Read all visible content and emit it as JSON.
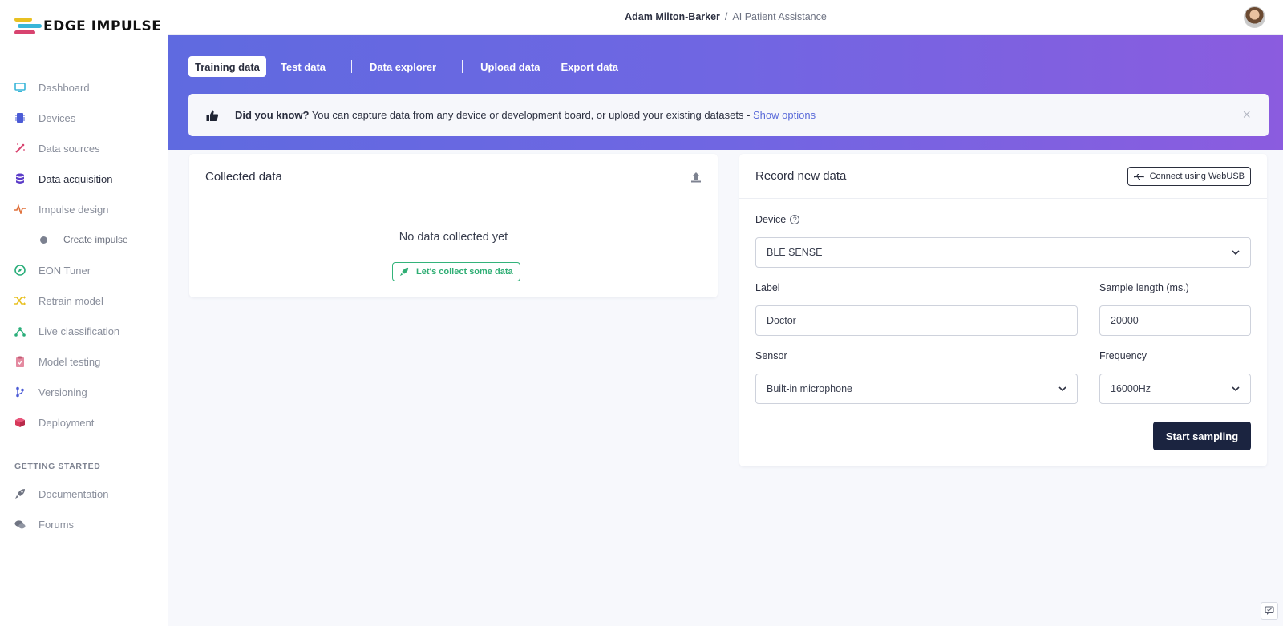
{
  "brand": {
    "name": "EDGE IMPULSE"
  },
  "sidebar": {
    "items": [
      {
        "label": "Dashboard",
        "icon": "monitor-icon",
        "color": "#38b6d8"
      },
      {
        "label": "Devices",
        "icon": "chip-icon",
        "color": "#4b5bd6"
      },
      {
        "label": "Data sources",
        "icon": "wand-icon",
        "color": "#d8436f"
      },
      {
        "label": "Data acquisition",
        "icon": "database-icon",
        "color": "#5b3bc8"
      },
      {
        "label": "Impulse design",
        "icon": "pulse-icon",
        "color": "#e0703a"
      },
      {
        "label": "Create impulse",
        "icon": "dot-icon",
        "color": "#7c8190"
      },
      {
        "label": "EON Tuner",
        "icon": "compass-icon",
        "color": "#2aae7a"
      },
      {
        "label": "Retrain model",
        "icon": "shuffle-icon",
        "color": "#e8c021"
      },
      {
        "label": "Live classification",
        "icon": "nodes-icon",
        "color": "#2aae7a"
      },
      {
        "label": "Model testing",
        "icon": "clipboard-check-icon",
        "color": "#e48aa0"
      },
      {
        "label": "Versioning",
        "icon": "branch-icon",
        "color": "#4b5bd6"
      },
      {
        "label": "Deployment",
        "icon": "box-icon",
        "color": "#d83a5a"
      }
    ],
    "section_title": "GETTING STARTED",
    "help_items": [
      {
        "label": "Documentation",
        "icon": "rocket-icon"
      },
      {
        "label": "Forums",
        "icon": "chat-icon"
      }
    ]
  },
  "topbar": {
    "user": "Adam Milton-Barker",
    "separator": "/",
    "project": "AI Patient Assistance"
  },
  "tabs": [
    {
      "label": "Training data",
      "active": true
    },
    {
      "label": "Test data"
    },
    {
      "label": "Data explorer"
    },
    {
      "label": "Upload data"
    },
    {
      "label": "Export data"
    }
  ],
  "tip": {
    "bold": "Did you know?",
    "text": " You can capture data from any device or development board, or upload your existing datasets - ",
    "link": "Show options",
    "close": "×"
  },
  "collected": {
    "title": "Collected data",
    "empty": "No data collected yet",
    "button": "Let's collect some data"
  },
  "record": {
    "title": "Record new data",
    "webusb_button": "Connect using WebUSB",
    "device_label": "Device",
    "device_value": "BLE SENSE",
    "label_label": "Label",
    "label_value": "Doctor",
    "sample_label": "Sample length (ms.)",
    "sample_value": "20000",
    "sensor_label": "Sensor",
    "sensor_value": "Built-in microphone",
    "frequency_label": "Frequency",
    "frequency_value": "16000Hz",
    "start_button": "Start sampling"
  },
  "colors": {
    "accent": "#5b6bd9",
    "banner_start": "#5f6ae0",
    "banner_end": "#8b5cdf",
    "primary_button": "#1b2440",
    "success": "#2fae74"
  }
}
